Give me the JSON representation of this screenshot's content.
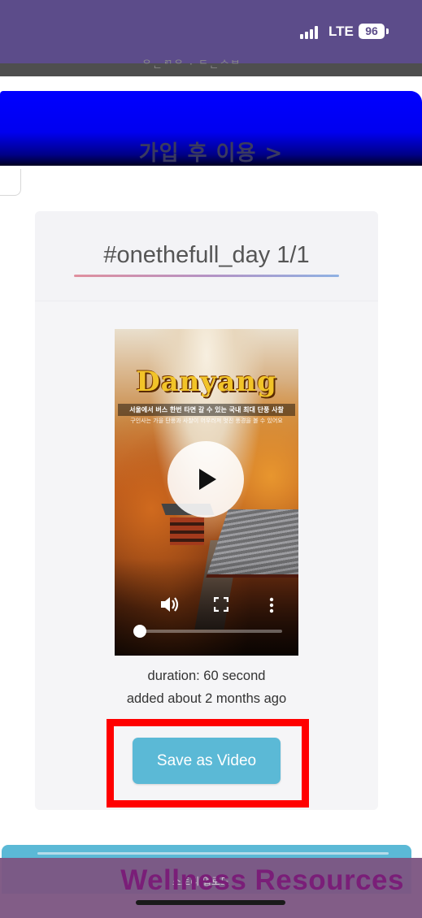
{
  "status_bar": {
    "network": "LTE",
    "battery": "96"
  },
  "header": {
    "ghost_text": "ᄋᆫᄅᄀᄋ · ᄃᆫᄉᄇ",
    "banner_text": "가입 후 이용 >"
  },
  "card": {
    "title": "#onethefull_day 1/1",
    "video": {
      "overlay_title": "Danyang",
      "overlay_subtitle": "서울에서 버스 한번 타면 갈 수 있는 국내 최대 단풍 사찰",
      "overlay_caption": "구인사는 가을 단풍과 사찰이 어우러져 멋진 풍경을 볼 수 있어요",
      "progress": 0.03
    },
    "duration": "duration: 60 second",
    "added": "added about 2 months ago",
    "save_button": "Save as Video"
  },
  "footer": {
    "ghost_text": "스토리 업로드",
    "brand": "Wellness Resources"
  },
  "icons": {
    "play": "play-icon",
    "volume": "volume-icon",
    "fullscreen": "fullscreen-icon",
    "more": "more-vertical-icon"
  }
}
